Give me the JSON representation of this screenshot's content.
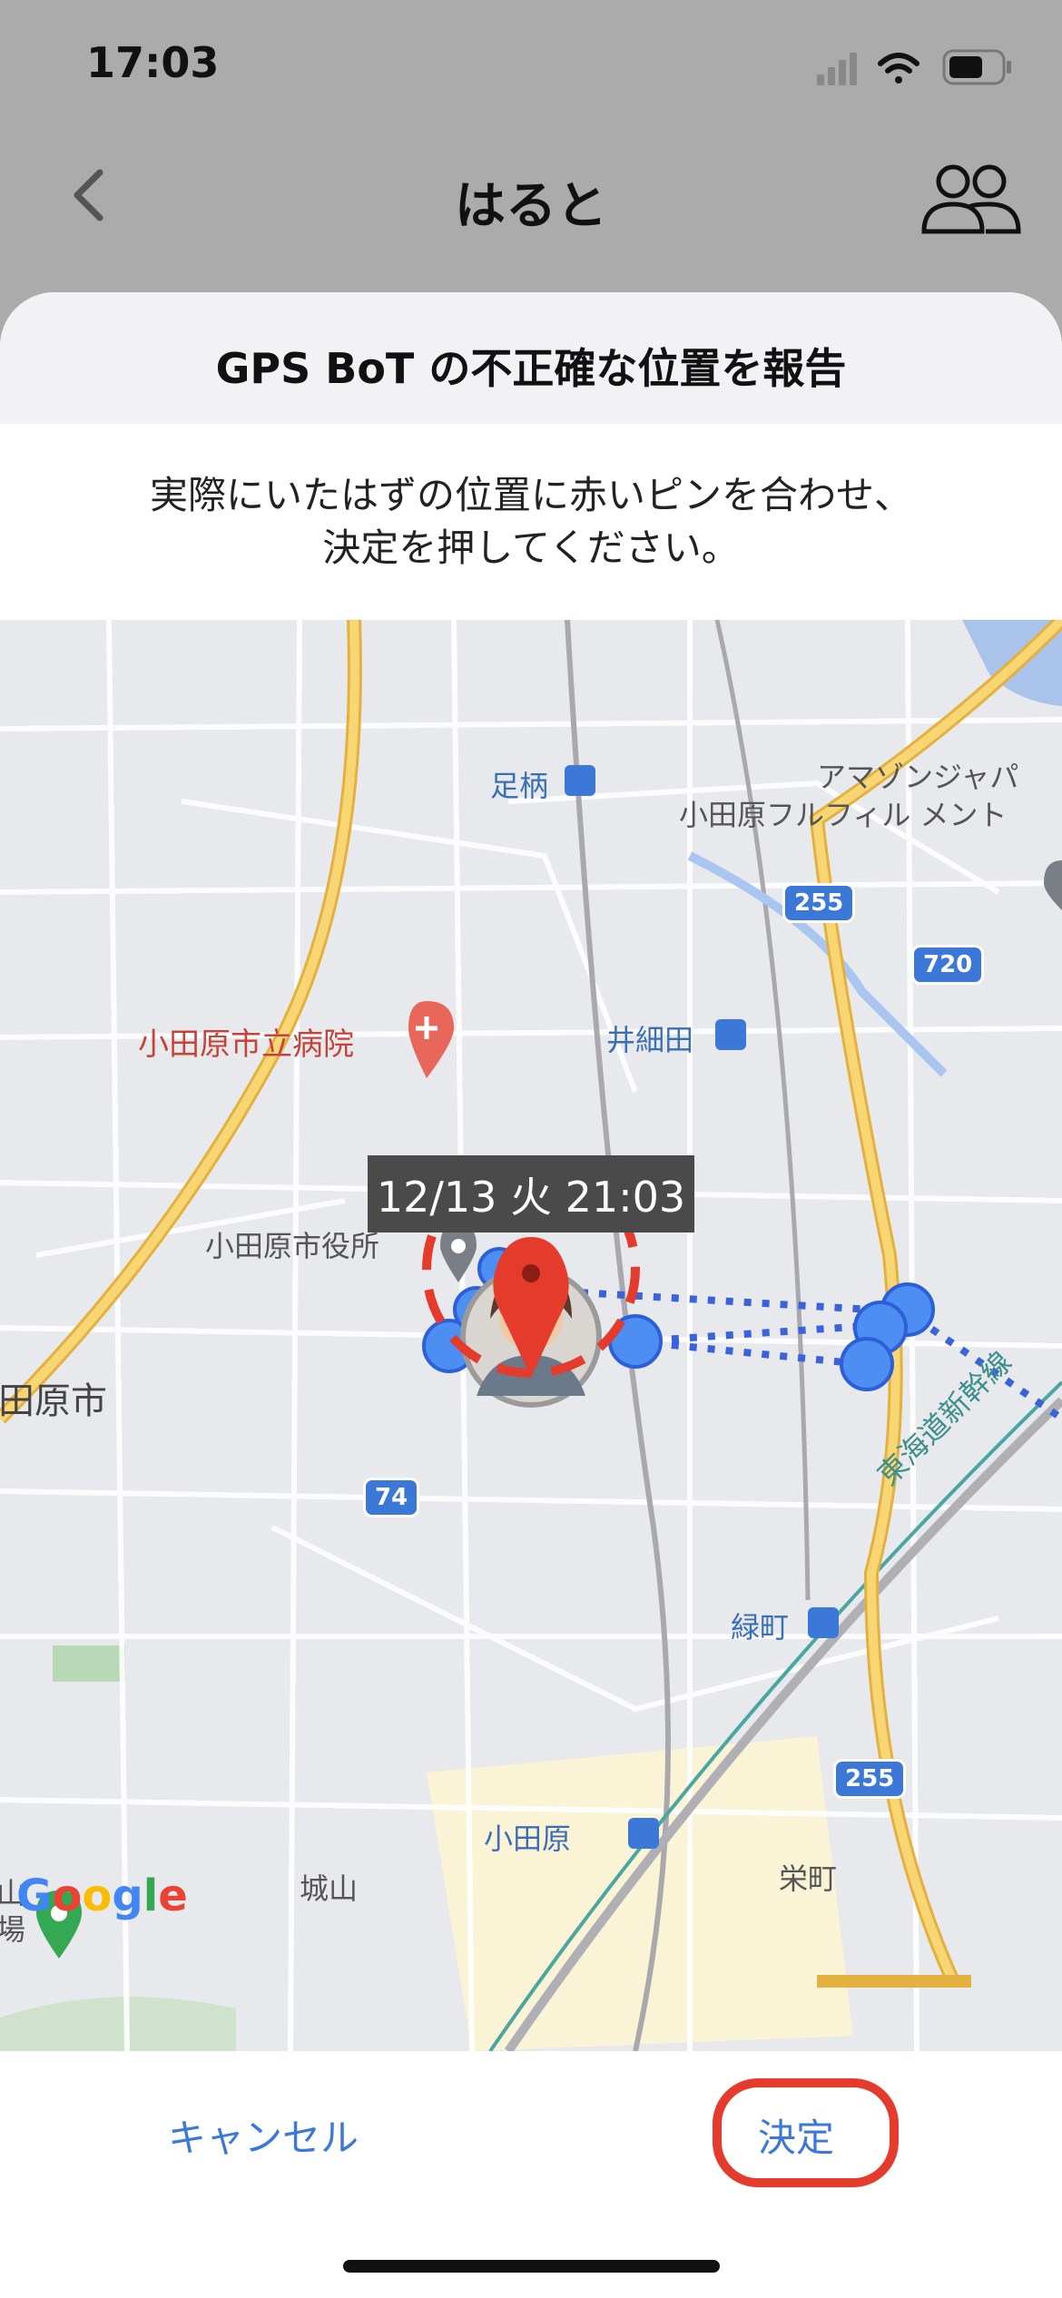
{
  "status_bar": {
    "time": "17:03"
  },
  "nav": {
    "title": "はると"
  },
  "sheet": {
    "title": "GPS BoT の不正確な位置を報告",
    "instruction_line1": "実際にいたはずの位置に赤いピンを合わせ、",
    "instruction_line2": "決定を押してください。"
  },
  "map": {
    "labels": {
      "ashigara": "足柄",
      "amazon": "アマゾンジャパ",
      "fulfillment": "小田原フルフィル メント",
      "hospital": "小田原市立病院",
      "isaida": "井細田",
      "city_hall": "小田原市役所",
      "city": "田原市",
      "shinkansen": "東海道新幹線",
      "midoricho": "緑町",
      "odawara": "小田原",
      "shiroyama": "城山",
      "sakaecho": "栄町",
      "left_edge_1": "山",
      "left_edge_2": "場"
    },
    "road_numbers": {
      "r255a": "255",
      "r720": "720",
      "r74": "74",
      "r255b": "255"
    },
    "tooltip": "12/13 火 21:03",
    "google": "Google"
  },
  "actions": {
    "cancel": "キャンセル",
    "confirm": "決定"
  },
  "colors": {
    "accent": "#3b78d8",
    "pin": "#e53b2c",
    "highway": "#f5c24a"
  }
}
